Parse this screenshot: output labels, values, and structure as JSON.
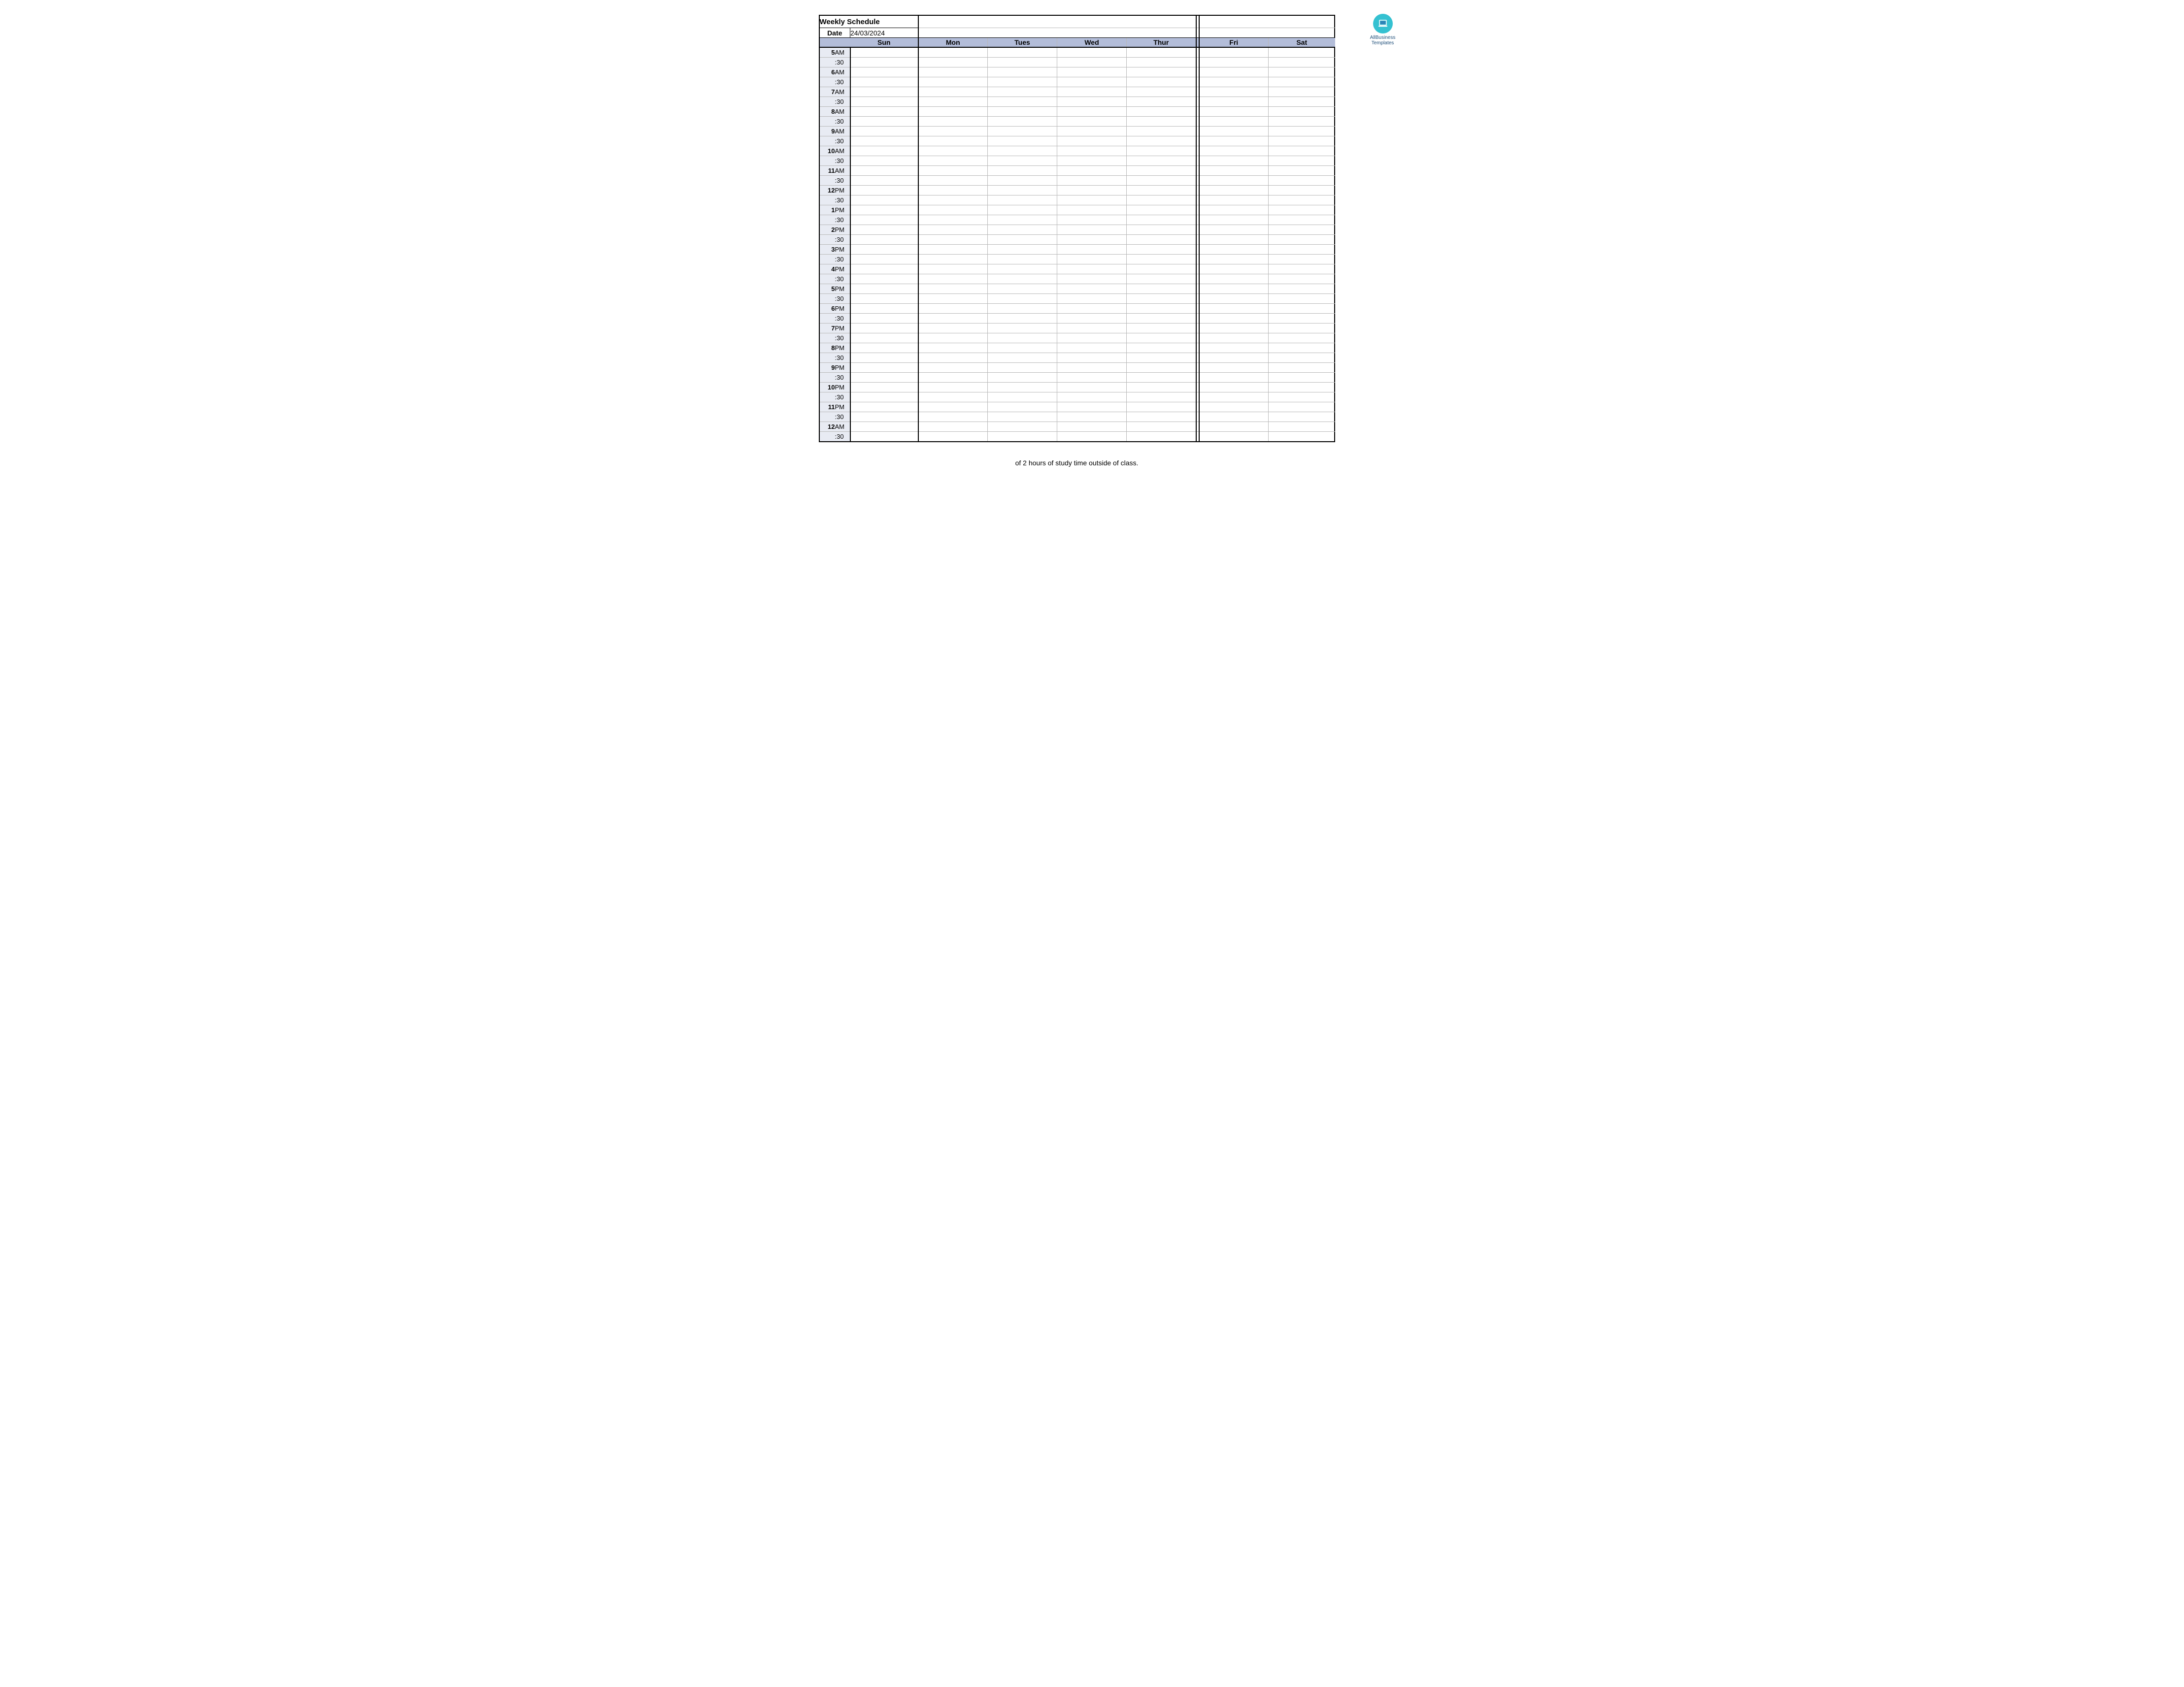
{
  "logo": {
    "line1": "AllBusiness",
    "line2": "Templates"
  },
  "schedule": {
    "title": "Weekly Schedule",
    "date_label": "Date",
    "date_value": "24/03/2024",
    "days": [
      "Sun",
      "Mon",
      "Tues",
      "Wed",
      "Thur",
      "Fri",
      "Sat"
    ],
    "time_slots": [
      {
        "h": "5",
        "m": "AM"
      },
      {
        "h": "",
        "m": ":30"
      },
      {
        "h": "6",
        "m": "AM"
      },
      {
        "h": "",
        "m": ":30"
      },
      {
        "h": "7",
        "m": "AM"
      },
      {
        "h": "",
        "m": ":30"
      },
      {
        "h": "8",
        "m": "AM"
      },
      {
        "h": "",
        "m": ":30"
      },
      {
        "h": "9",
        "m": "AM"
      },
      {
        "h": "",
        "m": ":30"
      },
      {
        "h": "10",
        "m": "AM"
      },
      {
        "h": "",
        "m": ":30"
      },
      {
        "h": "11",
        "m": "AM"
      },
      {
        "h": "",
        "m": ":30"
      },
      {
        "h": "12",
        "m": "PM"
      },
      {
        "h": "",
        "m": ":30"
      },
      {
        "h": "1",
        "m": "PM"
      },
      {
        "h": "",
        "m": ":30"
      },
      {
        "h": "2",
        "m": "PM"
      },
      {
        "h": "",
        "m": ":30"
      },
      {
        "h": "3",
        "m": "PM"
      },
      {
        "h": "",
        "m": ":30"
      },
      {
        "h": "4",
        "m": "PM"
      },
      {
        "h": "",
        "m": ":30"
      },
      {
        "h": "5",
        "m": "PM"
      },
      {
        "h": "",
        "m": ":30"
      },
      {
        "h": "6",
        "m": "PM"
      },
      {
        "h": "",
        "m": ":30"
      },
      {
        "h": "7",
        "m": "PM"
      },
      {
        "h": "",
        "m": ":30"
      },
      {
        "h": "8",
        "m": "PM"
      },
      {
        "h": "",
        "m": ":30"
      },
      {
        "h": "9",
        "m": "PM"
      },
      {
        "h": "",
        "m": ":30"
      },
      {
        "h": "10",
        "m": "PM"
      },
      {
        "h": "",
        "m": ":30"
      },
      {
        "h": "11",
        "m": "PM"
      },
      {
        "h": "",
        "m": ":30"
      },
      {
        "h": "12",
        "m": "AM"
      },
      {
        "h": "",
        "m": ":30"
      }
    ]
  },
  "footnote": "of 2 hours of study time outside of class."
}
